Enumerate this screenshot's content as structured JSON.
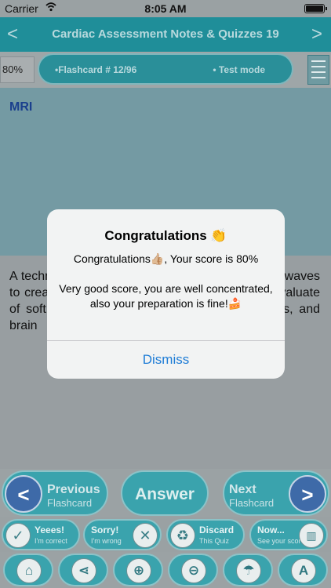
{
  "status_bar": {
    "carrier": "Carrier",
    "time": "8:05 AM"
  },
  "nav": {
    "title": "Cardiac Assessment Notes & Quizzes 19",
    "back_glyph": "<",
    "forward_glyph": ">"
  },
  "info_bar": {
    "score_percent": "80%",
    "flashcard_label": "•Flashcard #  12/96",
    "mode_label": "• Test mode"
  },
  "card": {
    "term": "MRI",
    "description": "A technique that uses a magnetic field and radio waves to create detailed images that can be used to evaluate of soft tissues such as the heart, blood vessels, and brain"
  },
  "alert": {
    "title": "Congratulations 👏",
    "message_line1": "Congratulations👍🏼, Your score is 80%",
    "message_line2": "Very good score, you are well concentrated, also your preparation is fine!🍰",
    "dismiss_label": "Dismiss"
  },
  "controls": {
    "previous": {
      "line1": "Previous",
      "line2": "Flashcard"
    },
    "answer": "Answer",
    "next": {
      "line1": "Next",
      "line2": "Flashcard"
    },
    "yes": {
      "line1": "Yeees!",
      "line2": "I'm correct"
    },
    "sorry": {
      "line1": "Sorry!",
      "line2": "I'm wrong"
    },
    "discard": {
      "line1": "Discard",
      "line2": "This Quiz"
    },
    "now": {
      "line1": "Now...",
      "line2": "See your score"
    }
  },
  "toolbar": {
    "home_icon": "home-icon",
    "share_icon": "share-icon",
    "zoom_in_icon": "zoom-in-icon",
    "zoom_out_icon": "zoom-out-icon",
    "water_icon": "watering-can-icon",
    "font_icon": "font-icon"
  }
}
